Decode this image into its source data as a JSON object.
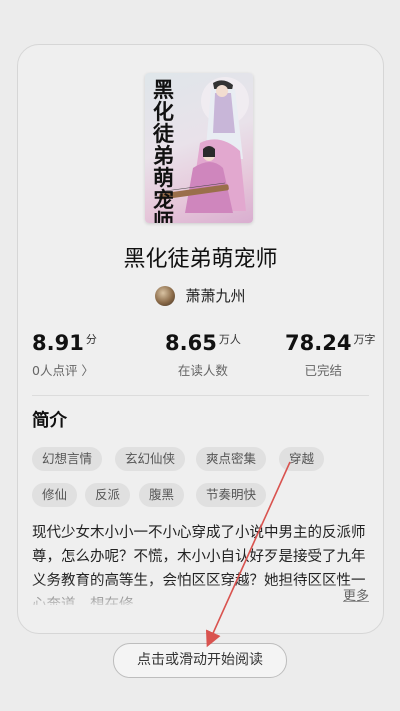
{
  "book": {
    "title": "黑化徒弟萌宠师",
    "cover_title": "黑化徒弟萌宠师",
    "author": "萧萧九州"
  },
  "stats": [
    {
      "value": "8.91",
      "unit": "分",
      "label": "0人点评 〉"
    },
    {
      "value": "8.65",
      "unit": "万人",
      "label": "在读人数"
    },
    {
      "value": "78.24",
      "unit": "万字",
      "label": "已完结"
    }
  ],
  "intro": {
    "title": "简介",
    "tags": [
      "幻想言情",
      "玄幻仙侠",
      "爽点密集",
      "穿越",
      "修仙",
      "反派",
      "腹黑",
      "节奏明快"
    ],
    "text": "现代少女木小小一不小心穿成了小说中男主的反派师尊，怎么办呢？不慌，木小小自认好歹是接受了九年义务教育的高等生，会怕区区穿越？她担待区区性一心奔道，想在修",
    "more_label": "更多"
  },
  "start_button": "点击或滑动开始阅读",
  "colors": {
    "annotation_arrow": "#d9534f",
    "card_bg": "#efefef"
  }
}
